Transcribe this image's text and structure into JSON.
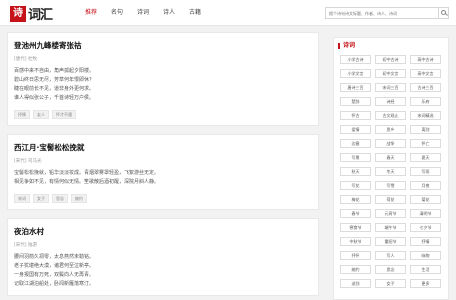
{
  "header": {
    "logo_badge": "诗",
    "logo_text": "词汇",
    "nav": [
      "推荐",
      "名句",
      "诗词",
      "诗人",
      "古籍"
    ],
    "search_placeholder": "搜个诗句诗文标题、作者、诗人、诗词"
  },
  "colors": {
    "accent": "#c6131a"
  },
  "cards": [
    {
      "title": "登池州九峰楼寄张祜",
      "meta": "[唐代] 杜牧",
      "lines": [
        "百感中来不自由，角声孤起夕阳楼。",
        "碧山终日思无尽，芳草何年恨即休？",
        "睫在眼前长不见，道非身外更何求。",
        "谁人得似张公子，千首诗轻万户侯。"
      ],
      "tags": [
        "抒情",
        "友人",
        "怀才不遇"
      ]
    },
    {
      "title": "西江月·宝髻松松挽就",
      "meta": "[宋代] 司马光",
      "lines": [
        "宝髻松松挽就，铅华淡淡妆成。青烟翠雾罩轻盈，飞絮游丝无定。",
        "相见争如不见，有情何似无情。笙歌散后酒初醒，深院月斜人静。"
      ],
      "tags": [
        "宋词",
        "女子",
        "思念",
        "婉约"
      ]
    },
    {
      "title": "夜泊水村",
      "meta": "[宋代] 陆游",
      "lines": [
        "腰间羽箭久凋零，太息燕然未勒铭。",
        "老子犹堪绝大漠，诸君何至泣新亭。",
        "一身报国有万死，双鬓向人无再青。",
        "记取江湖泊船处，卧闻新雁落寒汀。"
      ],
      "tags": []
    }
  ],
  "sidebar": {
    "title": "诗词",
    "items": [
      "小学古诗",
      "初中古诗",
      "高中古诗",
      "小学文言",
      "初中文言",
      "高中文言",
      "唐诗三百",
      "宋词三百",
      "古诗三百",
      "楚辞",
      "诗经",
      "乐府",
      "怀古",
      "古文观止",
      "宋词精选",
      "爱情",
      "思乡",
      "离别",
      "边塞",
      "战争",
      "怀亡",
      "写景",
      "春天",
      "夏天",
      "秋天",
      "冬天",
      "写雨",
      "写花",
      "写雪",
      "月夜",
      "梅花",
      "荷花",
      "菊花",
      "春节",
      "元宵节",
      "清明节",
      "寒食节",
      "端午节",
      "七夕节",
      "中秋节",
      "重阳节",
      "抒情",
      "抒怀",
      "写人",
      "咏物",
      "婉约",
      "思念",
      "生活",
      "送别",
      "女子",
      "更多"
    ]
  }
}
